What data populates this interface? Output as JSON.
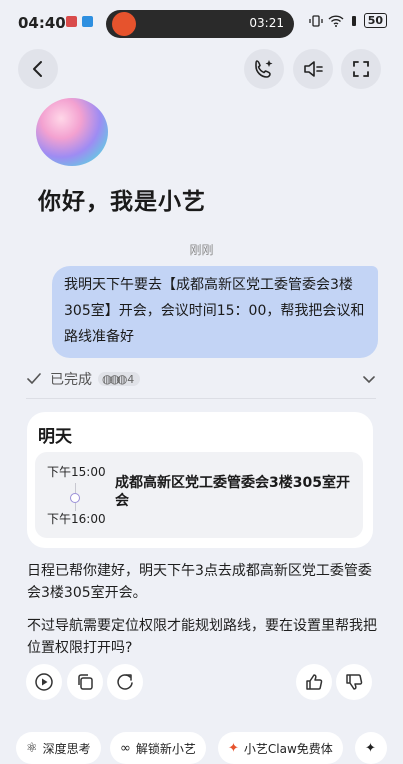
{
  "status_bar": {
    "time": "04:40",
    "pill_time": "03:21",
    "battery": "50"
  },
  "header": {
    "back_label": "‹"
  },
  "welcome": {
    "greeting": "你好，我是小艺"
  },
  "chat": {
    "timestamp": "刚刚",
    "user_message": "我明天下午要去【成都高新区党工委管委会3楼305室】开会，会议时间15：00，帮我把会议和路线准备好",
    "status": {
      "label": "已完成",
      "count": "4"
    },
    "schedule_card": {
      "title": "明天",
      "event": {
        "start": "下午15:00",
        "end": "下午16:00",
        "title": "成都高新区党工委管委会3楼305室开会"
      }
    },
    "reply_1": "日程已帮你建好，明天下午3点去成都高新区党工委管委会3楼305室开会。",
    "reply_2": "不过导航需要定位权限才能规划路线，要在设置里帮我把位置权限打开吗?"
  },
  "suggestions": [
    {
      "label": "深度思考",
      "icon": "atom-icon"
    },
    {
      "label": "解锁新小艺",
      "icon": "infinity-icon"
    },
    {
      "label": "小艺Claw免费体",
      "icon": "claw-icon"
    }
  ],
  "colors": {
    "user_bubble": "#c3d4f5",
    "accent": "#e6532d"
  }
}
